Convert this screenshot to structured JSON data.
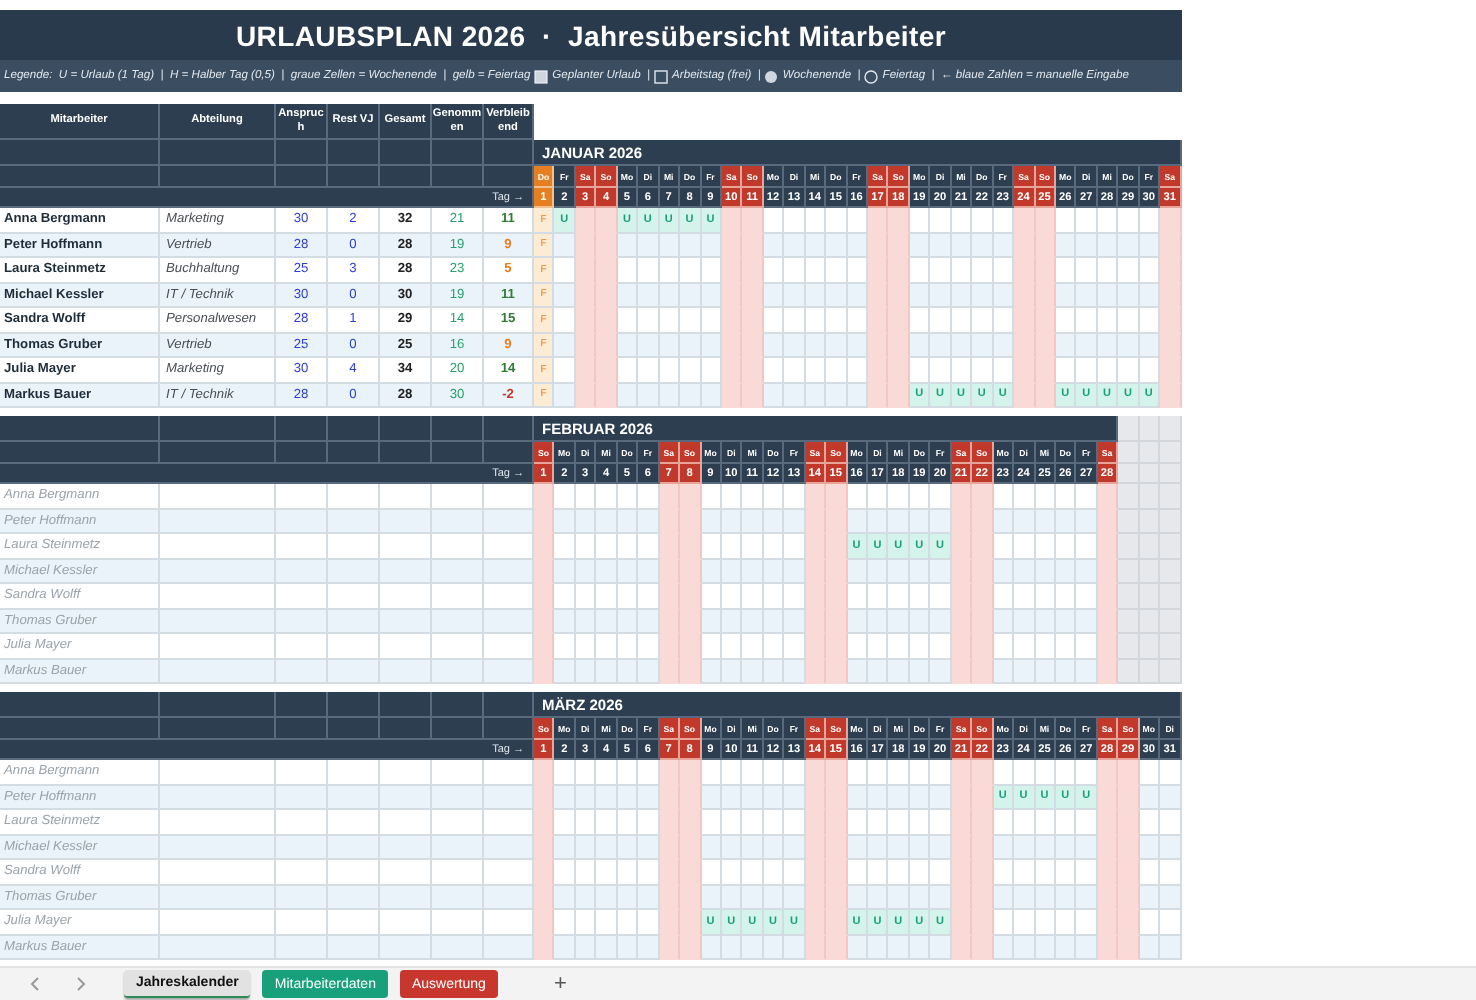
{
  "title": "URLAUBSPLAN 2026  ·  Jahresübersicht Mitarbeiter",
  "legend": [
    {
      "kind": "text",
      "text": "Legende:  U = Urlaub (1 Tag)  |  H = Halber Tag (0,5)  |  graue Zellen = Wochenende  |  gelb = Feiertag"
    },
    {
      "kind": "filled-square"
    },
    {
      "kind": "text",
      "text": "Geplanter Urlaub  |"
    },
    {
      "kind": "square"
    },
    {
      "kind": "text",
      "text": "Arbeitstag (frei)  |"
    },
    {
      "kind": "filled-circle"
    },
    {
      "kind": "text",
      "text": "Wochenende  |"
    },
    {
      "kind": "circle"
    },
    {
      "kind": "text",
      "text": "Feiertag  |  ← blaue Zahlen = manuelle Eingabe"
    }
  ],
  "columns": [
    "Mitarbeiter",
    "Abteilung",
    "Anspruch",
    "Rest VJ",
    "Gesamt",
    "Genommen",
    "Verbleibend"
  ],
  "months": [
    {
      "title": "JANUAR 2026",
      "day_row_label": "Tag →",
      "days": [
        {
          "weekday": "Do",
          "date": "1",
          "kind": "holiday"
        },
        {
          "weekday": "Fr",
          "date": "2",
          "kind": "workday"
        },
        {
          "weekday": "Sa",
          "date": "3",
          "kind": "weekend"
        },
        {
          "weekday": "So",
          "date": "4",
          "kind": "weekend"
        },
        {
          "weekday": "Mo",
          "date": "5",
          "kind": "workday"
        },
        {
          "weekday": "Di",
          "date": "6",
          "kind": "workday"
        },
        {
          "weekday": "Mi",
          "date": "7",
          "kind": "workday"
        },
        {
          "weekday": "Do",
          "date": "8",
          "kind": "workday"
        },
        {
          "weekday": "Fr",
          "date": "9",
          "kind": "workday"
        },
        {
          "weekday": "Sa",
          "date": "10",
          "kind": "weekend"
        },
        {
          "weekday": "So",
          "date": "11",
          "kind": "weekend"
        },
        {
          "weekday": "Mo",
          "date": "12",
          "kind": "workday"
        },
        {
          "weekday": "Di",
          "date": "13",
          "kind": "workday"
        },
        {
          "weekday": "Mi",
          "date": "14",
          "kind": "workday"
        },
        {
          "weekday": "Do",
          "date": "15",
          "kind": "workday"
        },
        {
          "weekday": "Fr",
          "date": "16",
          "kind": "workday"
        },
        {
          "weekday": "Sa",
          "date": "17",
          "kind": "weekend"
        },
        {
          "weekday": "So",
          "date": "18",
          "kind": "weekend"
        },
        {
          "weekday": "Mo",
          "date": "19",
          "kind": "workday"
        },
        {
          "weekday": "Di",
          "date": "20",
          "kind": "workday"
        },
        {
          "weekday": "Mi",
          "date": "21",
          "kind": "workday"
        },
        {
          "weekday": "Do",
          "date": "22",
          "kind": "workday"
        },
        {
          "weekday": "Fr",
          "date": "23",
          "kind": "workday"
        },
        {
          "weekday": "Sa",
          "date": "24",
          "kind": "weekend"
        },
        {
          "weekday": "So",
          "date": "25",
          "kind": "weekend"
        },
        {
          "weekday": "Mo",
          "date": "26",
          "kind": "workday"
        },
        {
          "weekday": "Di",
          "date": "27",
          "kind": "workday"
        },
        {
          "weekday": "Mi",
          "date": "28",
          "kind": "workday"
        },
        {
          "weekday": "Do",
          "date": "29",
          "kind": "workday"
        },
        {
          "weekday": "Fr",
          "date": "30",
          "kind": "workday"
        },
        {
          "weekday": "Sa",
          "date": "31",
          "kind": "weekend"
        }
      ],
      "rows": [
        {
          "name": "Anna Bergmann",
          "muted": false,
          "department": "Marketing",
          "entitlement": "30",
          "carryover": "2",
          "total": "32",
          "taken": "21",
          "remaining": {
            "text": "11",
            "color": "#2e7d32"
          },
          "cells": [
            "F",
            "U",
            null,
            null,
            "U",
            "U",
            "U",
            "U",
            "U",
            null,
            null,
            null,
            null,
            null,
            null,
            null,
            null,
            null,
            null,
            null,
            null,
            null,
            null,
            null,
            null,
            null,
            null,
            null,
            null,
            null,
            null
          ]
        },
        {
          "name": "Peter Hoffmann",
          "muted": false,
          "department": "Vertrieb",
          "entitlement": "28",
          "carryover": "0",
          "total": "28",
          "taken": "19",
          "remaining": {
            "text": "9",
            "color": "#e67e22"
          },
          "cells": [
            "F",
            null,
            null,
            null,
            null,
            null,
            null,
            null,
            null,
            null,
            null,
            null,
            null,
            null,
            null,
            null,
            null,
            null,
            null,
            null,
            null,
            null,
            null,
            null,
            null,
            null,
            null,
            null,
            null,
            null,
            null
          ]
        },
        {
          "name": "Laura Steinmetz",
          "muted": false,
          "department": "Buchhaltung",
          "entitlement": "25",
          "carryover": "3",
          "total": "28",
          "taken": "23",
          "remaining": {
            "text": "5",
            "color": "#e67e22"
          },
          "cells": [
            "F",
            null,
            null,
            null,
            null,
            null,
            null,
            null,
            null,
            null,
            null,
            null,
            null,
            null,
            null,
            null,
            null,
            null,
            null,
            null,
            null,
            null,
            null,
            null,
            null,
            null,
            null,
            null,
            null,
            null,
            null
          ]
        },
        {
          "name": "Michael Kessler",
          "muted": false,
          "department": "IT / Technik",
          "entitlement": "30",
          "carryover": "0",
          "total": "30",
          "taken": "19",
          "remaining": {
            "text": "11",
            "color": "#2e7d32"
          },
          "cells": [
            "F",
            null,
            null,
            null,
            null,
            null,
            null,
            null,
            null,
            null,
            null,
            null,
            null,
            null,
            null,
            null,
            null,
            null,
            null,
            null,
            null,
            null,
            null,
            null,
            null,
            null,
            null,
            null,
            null,
            null,
            null
          ]
        },
        {
          "name": "Sandra Wolff",
          "muted": false,
          "department": "Personalwesen",
          "entitlement": "28",
          "carryover": "1",
          "total": "29",
          "taken": "14",
          "remaining": {
            "text": "15",
            "color": "#2e7d32"
          },
          "cells": [
            "F",
            null,
            null,
            null,
            null,
            null,
            null,
            null,
            null,
            null,
            null,
            null,
            null,
            null,
            null,
            null,
            null,
            null,
            null,
            null,
            null,
            null,
            null,
            null,
            null,
            null,
            null,
            null,
            null,
            null,
            null
          ]
        },
        {
          "name": "Thomas Gruber",
          "muted": false,
          "department": "Vertrieb",
          "entitlement": "25",
          "carryover": "0",
          "total": "25",
          "taken": "16",
          "remaining": {
            "text": "9",
            "color": "#e67e22"
          },
          "cells": [
            "F",
            null,
            null,
            null,
            null,
            null,
            null,
            null,
            null,
            null,
            null,
            null,
            null,
            null,
            null,
            null,
            null,
            null,
            null,
            null,
            null,
            null,
            null,
            null,
            null,
            null,
            null,
            null,
            null,
            null,
            null
          ]
        },
        {
          "name": "Julia Mayer",
          "muted": false,
          "department": "Marketing",
          "entitlement": "30",
          "carryover": "4",
          "total": "34",
          "taken": "20",
          "remaining": {
            "text": "14",
            "color": "#2e7d32"
          },
          "cells": [
            "F",
            null,
            null,
            null,
            null,
            null,
            null,
            null,
            null,
            null,
            null,
            null,
            null,
            null,
            null,
            null,
            null,
            null,
            null,
            null,
            null,
            null,
            null,
            null,
            null,
            null,
            null,
            null,
            null,
            null,
            null
          ]
        },
        {
          "name": "Markus Bauer",
          "muted": false,
          "department": "IT / Technik",
          "entitlement": "28",
          "carryover": "0",
          "total": "28",
          "taken": "30",
          "remaining": {
            "text": "-2",
            "color": "#c0392b"
          },
          "cells": [
            "F",
            null,
            null,
            null,
            null,
            null,
            null,
            null,
            null,
            null,
            null,
            null,
            null,
            null,
            null,
            null,
            null,
            null,
            "U",
            "U",
            "U",
            "U",
            "U",
            null,
            null,
            "U",
            "U",
            "U",
            "U",
            "U",
            null
          ]
        }
      ]
    },
    {
      "title": "FEBRUAR 2026",
      "day_row_label": "Tag →",
      "days": [
        {
          "weekday": "So",
          "date": "1",
          "kind": "weekend"
        },
        {
          "weekday": "Mo",
          "date": "2",
          "kind": "workday"
        },
        {
          "weekday": "Di",
          "date": "3",
          "kind": "workday"
        },
        {
          "weekday": "Mi",
          "date": "4",
          "kind": "workday"
        },
        {
          "weekday": "Do",
          "date": "5",
          "kind": "workday"
        },
        {
          "weekday": "Fr",
          "date": "6",
          "kind": "workday"
        },
        {
          "weekday": "Sa",
          "date": "7",
          "kind": "weekend"
        },
        {
          "weekday": "So",
          "date": "8",
          "kind": "weekend"
        },
        {
          "weekday": "Mo",
          "date": "9",
          "kind": "workday"
        },
        {
          "weekday": "Di",
          "date": "10",
          "kind": "workday"
        },
        {
          "weekday": "Mi",
          "date": "11",
          "kind": "workday"
        },
        {
          "weekday": "Do",
          "date": "12",
          "kind": "workday"
        },
        {
          "weekday": "Fr",
          "date": "13",
          "kind": "workday"
        },
        {
          "weekday": "Sa",
          "date": "14",
          "kind": "weekend"
        },
        {
          "weekday": "So",
          "date": "15",
          "kind": "weekend"
        },
        {
          "weekday": "Mo",
          "date": "16",
          "kind": "workday"
        },
        {
          "weekday": "Di",
          "date": "17",
          "kind": "workday"
        },
        {
          "weekday": "Mi",
          "date": "18",
          "kind": "workday"
        },
        {
          "weekday": "Do",
          "date": "19",
          "kind": "workday"
        },
        {
          "weekday": "Fr",
          "date": "20",
          "kind": "workday"
        },
        {
          "weekday": "Sa",
          "date": "21",
          "kind": "weekend"
        },
        {
          "weekday": "So",
          "date": "22",
          "kind": "weekend"
        },
        {
          "weekday": "Mo",
          "date": "23",
          "kind": "workday"
        },
        {
          "weekday": "Di",
          "date": "24",
          "kind": "workday"
        },
        {
          "weekday": "Mi",
          "date": "25",
          "kind": "workday"
        },
        {
          "weekday": "Do",
          "date": "26",
          "kind": "workday"
        },
        {
          "weekday": "Fr",
          "date": "27",
          "kind": "workday"
        },
        {
          "weekday": "Sa",
          "date": "28",
          "kind": "weekend"
        }
      ],
      "rows": [
        {
          "name": "Anna Bergmann",
          "muted": true
        },
        {
          "name": "Peter Hoffmann",
          "muted": true
        },
        {
          "name": "Laura Steinmetz",
          "muted": true,
          "cells": [
            null,
            null,
            null,
            null,
            null,
            null,
            null,
            null,
            null,
            null,
            null,
            null,
            null,
            null,
            null,
            "U",
            "U",
            "U",
            "U",
            "U",
            null,
            null,
            null,
            null,
            null,
            null,
            null,
            null
          ]
        },
        {
          "name": "Michael Kessler",
          "muted": true
        },
        {
          "name": "Sandra Wolff",
          "muted": true
        },
        {
          "name": "Thomas Gruber",
          "muted": true
        },
        {
          "name": "Julia Mayer",
          "muted": true
        },
        {
          "name": "Markus Bauer",
          "muted": true
        }
      ]
    },
    {
      "title": "MÄRZ 2026",
      "day_row_label": "Tag →",
      "days": [
        {
          "weekday": "So",
          "date": "1",
          "kind": "weekend"
        },
        {
          "weekday": "Mo",
          "date": "2",
          "kind": "workday"
        },
        {
          "weekday": "Di",
          "date": "3",
          "kind": "workday"
        },
        {
          "weekday": "Mi",
          "date": "4",
          "kind": "workday"
        },
        {
          "weekday": "Do",
          "date": "5",
          "kind": "workday"
        },
        {
          "weekday": "Fr",
          "date": "6",
          "kind": "workday"
        },
        {
          "weekday": "Sa",
          "date": "7",
          "kind": "weekend"
        },
        {
          "weekday": "So",
          "date": "8",
          "kind": "weekend"
        },
        {
          "weekday": "Mo",
          "date": "9",
          "kind": "workday"
        },
        {
          "weekday": "Di",
          "date": "10",
          "kind": "workday"
        },
        {
          "weekday": "Mi",
          "date": "11",
          "kind": "workday"
        },
        {
          "weekday": "Do",
          "date": "12",
          "kind": "workday"
        },
        {
          "weekday": "Fr",
          "date": "13",
          "kind": "workday"
        },
        {
          "weekday": "Sa",
          "date": "14",
          "kind": "weekend"
        },
        {
          "weekday": "So",
          "date": "15",
          "kind": "weekend"
        },
        {
          "weekday": "Mo",
          "date": "16",
          "kind": "workday"
        },
        {
          "weekday": "Di",
          "date": "17",
          "kind": "workday"
        },
        {
          "weekday": "Mi",
          "date": "18",
          "kind": "workday"
        },
        {
          "weekday": "Do",
          "date": "19",
          "kind": "workday"
        },
        {
          "weekday": "Fr",
          "date": "20",
          "kind": "workday"
        },
        {
          "weekday": "Sa",
          "date": "21",
          "kind": "weekend"
        },
        {
          "weekday": "So",
          "date": "22",
          "kind": "weekend"
        },
        {
          "weekday": "Mo",
          "date": "23",
          "kind": "workday"
        },
        {
          "weekday": "Di",
          "date": "24",
          "kind": "workday"
        },
        {
          "weekday": "Mi",
          "date": "25",
          "kind": "workday"
        },
        {
          "weekday": "Do",
          "date": "26",
          "kind": "workday"
        },
        {
          "weekday": "Fr",
          "date": "27",
          "kind": "workday"
        },
        {
          "weekday": "Sa",
          "date": "28",
          "kind": "weekend"
        },
        {
          "weekday": "So",
          "date": "29",
          "kind": "weekend"
        },
        {
          "weekday": "Mo",
          "date": "30",
          "kind": "workday"
        },
        {
          "weekday": "Di",
          "date": "31",
          "kind": "workday"
        }
      ],
      "rows": [
        {
          "name": "Anna Bergmann",
          "muted": true
        },
        {
          "name": "Peter Hoffmann",
          "muted": true,
          "cells": [
            null,
            null,
            null,
            null,
            null,
            null,
            null,
            null,
            null,
            null,
            null,
            null,
            null,
            null,
            null,
            null,
            null,
            null,
            null,
            null,
            null,
            null,
            "U",
            "U",
            "U",
            "U",
            "U",
            null,
            null,
            null,
            null
          ]
        },
        {
          "name": "Laura Steinmetz",
          "muted": true
        },
        {
          "name": "Michael Kessler",
          "muted": true
        },
        {
          "name": "Sandra Wolff",
          "muted": true
        },
        {
          "name": "Thomas Gruber",
          "muted": true
        },
        {
          "name": "Julia Mayer",
          "muted": true,
          "cells": [
            null,
            null,
            null,
            null,
            null,
            null,
            null,
            null,
            "U",
            "U",
            "U",
            "U",
            "U",
            null,
            null,
            "U",
            "U",
            "U",
            "U",
            "U",
            null,
            null,
            null,
            null,
            null,
            null,
            null,
            null,
            null,
            null,
            null
          ]
        },
        {
          "name": "Markus Bauer",
          "muted": true
        }
      ]
    }
  ],
  "tabs": [
    {
      "label": "Jahreskalender",
      "selected": true,
      "color": "#e2e2e2"
    },
    {
      "label": "Mitarbeiterdaten",
      "selected": false,
      "color": "#17a07a"
    },
    {
      "label": "Auswertung",
      "selected": false,
      "color": "#c8372d"
    }
  ],
  "add_sheet": "+"
}
